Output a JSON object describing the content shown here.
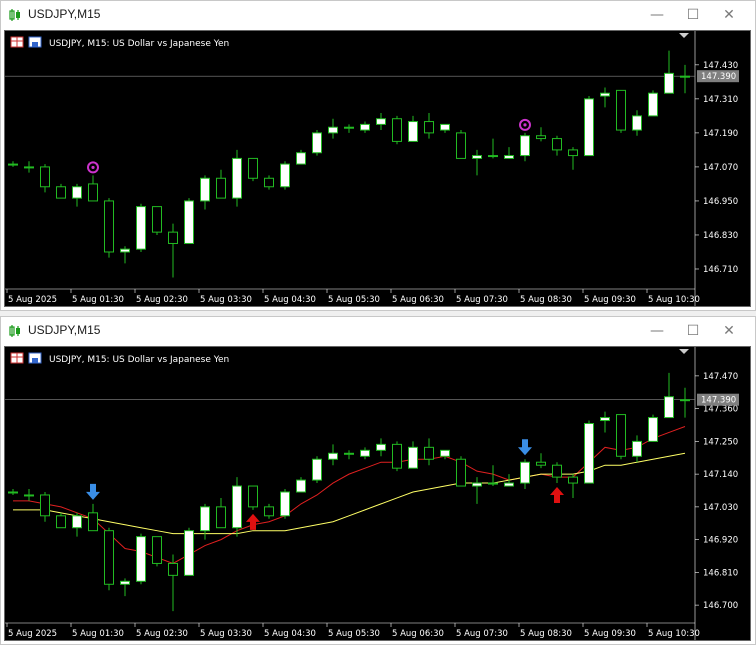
{
  "windows": [
    {
      "title": "USDJPY,M15",
      "chart_header": "USDJPY, M15:  US Dollar vs Japanese Yen",
      "controls": {
        "minimize": "—",
        "maximize": "☐",
        "close": "✕"
      },
      "price_label": "147.390",
      "y_ticks": [
        "147.430",
        "147.310",
        "147.190",
        "147.070",
        "146.950",
        "146.830",
        "146.710"
      ],
      "x_ticks": [
        "5 Aug 2025",
        "5 Aug 01:30",
        "5 Aug 02:30",
        "5 Aug 03:30",
        "5 Aug 04:30",
        "5 Aug 05:30",
        "5 Aug 06:30",
        "5 Aug 07:30",
        "5 Aug 08:30",
        "5 Aug 09:30",
        "5 Aug 10:30"
      ]
    },
    {
      "title": "USDJPY,M15",
      "chart_header": "USDJPY, M15:  US Dollar vs Japanese Yen",
      "controls": {
        "minimize": "—",
        "maximize": "☐",
        "close": "✕"
      },
      "price_label": "147.390",
      "y_ticks": [
        "147.470",
        "147.360",
        "147.250",
        "147.140",
        "147.030",
        "146.920",
        "146.810",
        "146.700"
      ],
      "x_ticks": [
        "5 Aug 2025",
        "5 Aug 01:30",
        "5 Aug 02:30",
        "5 Aug 03:30",
        "5 Aug 04:30",
        "5 Aug 05:30",
        "5 Aug 06:30",
        "5 Aug 07:30",
        "5 Aug 08:30",
        "5 Aug 09:30",
        "5 Aug 10:30"
      ]
    }
  ],
  "colors": {
    "bull": "#ffffff",
    "bear": "#000000",
    "wick": "#22bb22",
    "fast_ma": "#e02020",
    "slow_ma": "#ffff66",
    "buy_arrow": "#e01010",
    "sell_arrow": "#3a8ee6",
    "marker": "#cc33cc"
  },
  "chart_data": [
    {
      "type": "candlestick",
      "title": "USDJPY, M15:  US Dollar vs Japanese Yen",
      "ylim": [
        146.65,
        147.5
      ],
      "candles": [
        {
          "o": 147.08,
          "h": 147.09,
          "l": 147.07,
          "c": 147.08
        },
        {
          "o": 147.07,
          "h": 147.09,
          "l": 147.05,
          "c": 147.07
        },
        {
          "o": 147.07,
          "h": 147.08,
          "l": 146.98,
          "c": 147.0
        },
        {
          "o": 147.0,
          "h": 147.01,
          "l": 146.96,
          "c": 146.96
        },
        {
          "o": 146.96,
          "h": 147.01,
          "l": 146.93,
          "c": 147.0
        },
        {
          "o": 147.01,
          "h": 147.04,
          "l": 146.95,
          "c": 146.95
        },
        {
          "o": 146.95,
          "h": 146.96,
          "l": 146.75,
          "c": 146.77
        },
        {
          "o": 146.77,
          "h": 146.79,
          "l": 146.73,
          "c": 146.78
        },
        {
          "o": 146.78,
          "h": 146.94,
          "l": 146.77,
          "c": 146.93
        },
        {
          "o": 146.93,
          "h": 146.93,
          "l": 146.83,
          "c": 146.84
        },
        {
          "o": 146.84,
          "h": 146.87,
          "l": 146.68,
          "c": 146.8
        },
        {
          "o": 146.8,
          "h": 146.96,
          "l": 146.8,
          "c": 146.95
        },
        {
          "o": 146.95,
          "h": 147.04,
          "l": 146.92,
          "c": 147.03
        },
        {
          "o": 147.03,
          "h": 147.06,
          "l": 146.96,
          "c": 146.96
        },
        {
          "o": 146.96,
          "h": 147.13,
          "l": 146.93,
          "c": 147.1
        },
        {
          "o": 147.1,
          "h": 147.1,
          "l": 147.02,
          "c": 147.03
        },
        {
          "o": 147.03,
          "h": 147.04,
          "l": 146.99,
          "c": 147.0
        },
        {
          "o": 147.0,
          "h": 147.09,
          "l": 146.99,
          "c": 147.08
        },
        {
          "o": 147.08,
          "h": 147.13,
          "l": 147.08,
          "c": 147.12
        },
        {
          "o": 147.12,
          "h": 147.2,
          "l": 147.11,
          "c": 147.19
        },
        {
          "o": 147.19,
          "h": 147.24,
          "l": 147.17,
          "c": 147.21
        },
        {
          "o": 147.21,
          "h": 147.22,
          "l": 147.19,
          "c": 147.21
        },
        {
          "o": 147.2,
          "h": 147.23,
          "l": 147.19,
          "c": 147.22
        },
        {
          "o": 147.22,
          "h": 147.26,
          "l": 147.2,
          "c": 147.24
        },
        {
          "o": 147.24,
          "h": 147.25,
          "l": 147.15,
          "c": 147.16
        },
        {
          "o": 147.16,
          "h": 147.25,
          "l": 147.16,
          "c": 147.23
        },
        {
          "o": 147.23,
          "h": 147.26,
          "l": 147.17,
          "c": 147.19
        },
        {
          "o": 147.2,
          "h": 147.22,
          "l": 147.19,
          "c": 147.22
        },
        {
          "o": 147.19,
          "h": 147.2,
          "l": 147.1,
          "c": 147.1
        },
        {
          "o": 147.1,
          "h": 147.13,
          "l": 147.04,
          "c": 147.11
        },
        {
          "o": 147.11,
          "h": 147.17,
          "l": 147.1,
          "c": 147.11
        },
        {
          "o": 147.1,
          "h": 147.14,
          "l": 147.1,
          "c": 147.11
        },
        {
          "o": 147.11,
          "h": 147.19,
          "l": 147.09,
          "c": 147.18
        },
        {
          "o": 147.18,
          "h": 147.21,
          "l": 147.16,
          "c": 147.17
        },
        {
          "o": 147.17,
          "h": 147.18,
          "l": 147.11,
          "c": 147.13
        },
        {
          "o": 147.13,
          "h": 147.14,
          "l": 147.06,
          "c": 147.11
        },
        {
          "o": 147.11,
          "h": 147.32,
          "l": 147.11,
          "c": 147.31
        },
        {
          "o": 147.32,
          "h": 147.35,
          "l": 147.28,
          "c": 147.33
        },
        {
          "o": 147.34,
          "h": 147.34,
          "l": 147.19,
          "c": 147.2
        },
        {
          "o": 147.2,
          "h": 147.27,
          "l": 147.18,
          "c": 147.25
        },
        {
          "o": 147.25,
          "h": 147.34,
          "l": 147.25,
          "c": 147.33
        },
        {
          "o": 147.33,
          "h": 147.48,
          "l": 147.33,
          "c": 147.4
        },
        {
          "o": 147.39,
          "h": 147.43,
          "l": 147.33,
          "c": 147.39
        }
      ],
      "markers": [
        {
          "index": 5,
          "type": "circle-star"
        },
        {
          "index": 32,
          "type": "circle-star"
        }
      ]
    },
    {
      "type": "candlestick",
      "title": "USDJPY, M15:  US Dollar vs Japanese Yen",
      "ylim": [
        146.65,
        147.52
      ],
      "same_candles_as_chart": 0,
      "series": [
        {
          "name": "fast_ma",
          "values": [
            147.05,
            147.05,
            147.04,
            147.03,
            147.01,
            146.99,
            146.94,
            146.89,
            146.88,
            146.86,
            146.84,
            146.87,
            146.9,
            146.92,
            146.95,
            146.97,
            146.98,
            147.0,
            147.04,
            147.07,
            147.11,
            147.14,
            147.16,
            147.18,
            147.18,
            147.19,
            147.19,
            147.2,
            147.18,
            147.15,
            147.14,
            147.12,
            147.13,
            147.14,
            147.13,
            147.13,
            147.18,
            147.23,
            147.22,
            147.23,
            147.26,
            147.28,
            147.3
          ]
        },
        {
          "name": "slow_ma",
          "values": [
            147.02,
            147.02,
            147.02,
            147.01,
            147.0,
            146.99,
            146.98,
            146.97,
            146.96,
            146.95,
            146.94,
            146.94,
            146.94,
            146.94,
            146.94,
            146.95,
            146.95,
            146.95,
            146.96,
            146.97,
            146.98,
            147.0,
            147.02,
            147.04,
            147.06,
            147.08,
            147.09,
            147.1,
            147.11,
            147.11,
            147.11,
            147.12,
            147.13,
            147.14,
            147.14,
            147.14,
            147.15,
            147.17,
            147.17,
            147.18,
            147.19,
            147.2,
            147.21
          ]
        }
      ],
      "signals": [
        {
          "index": 5,
          "type": "sell"
        },
        {
          "index": 15,
          "type": "buy"
        },
        {
          "index": 32,
          "type": "sell"
        },
        {
          "index": 34,
          "type": "buy"
        }
      ]
    }
  ]
}
